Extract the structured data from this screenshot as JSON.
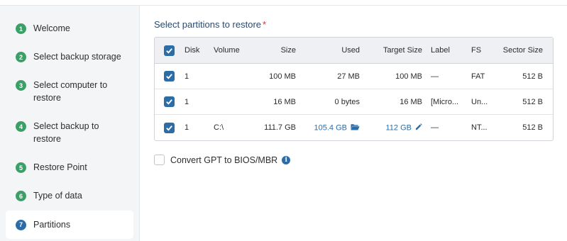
{
  "sidebar": {
    "steps": [
      {
        "num": "1",
        "label": "Welcome"
      },
      {
        "num": "2",
        "label": "Select backup storage"
      },
      {
        "num": "3",
        "label": "Select computer to restore"
      },
      {
        "num": "4",
        "label": "Select backup to restore"
      },
      {
        "num": "5",
        "label": "Restore Point"
      },
      {
        "num": "6",
        "label": "Type of data"
      },
      {
        "num": "7",
        "label": "Partitions"
      }
    ],
    "active_step": "7",
    "colors": {
      "done": "#3aa068",
      "active": "#2c6da8"
    }
  },
  "main": {
    "title": "Select partitions to restore",
    "required_mark": "*",
    "table": {
      "columns": [
        "Disk",
        "Volume",
        "Size",
        "Used",
        "Target Size",
        "Label",
        "FS",
        "Sector Size"
      ],
      "header_checked": true,
      "rows": [
        {
          "checked": true,
          "disk": "1",
          "volume": "",
          "size": "100 MB",
          "used": "27 MB",
          "target_size": "100 MB",
          "label": "—",
          "fs": "FAT",
          "sector_size": "512 B"
        },
        {
          "checked": true,
          "disk": "1",
          "volume": "",
          "size": "16 MB",
          "used": "0 bytes",
          "target_size": "16 MB",
          "label": "[Micro...",
          "fs": "Un...",
          "sector_size": "512 B"
        },
        {
          "checked": true,
          "disk": "1",
          "volume": "C:\\",
          "size": "111.7 GB",
          "used": "105.4 GB",
          "target_size": "112 GB",
          "label": "—",
          "fs": "NT...",
          "sector_size": "512 B"
        }
      ]
    },
    "convert_option": {
      "label": "Convert GPT to BIOS/MBR",
      "checked": false
    }
  },
  "icons": {
    "checkmark": "check-icon",
    "folder": "folder-open-icon",
    "edit": "pencil-icon",
    "info": "info-icon"
  },
  "accent_color": "#2c6da8"
}
